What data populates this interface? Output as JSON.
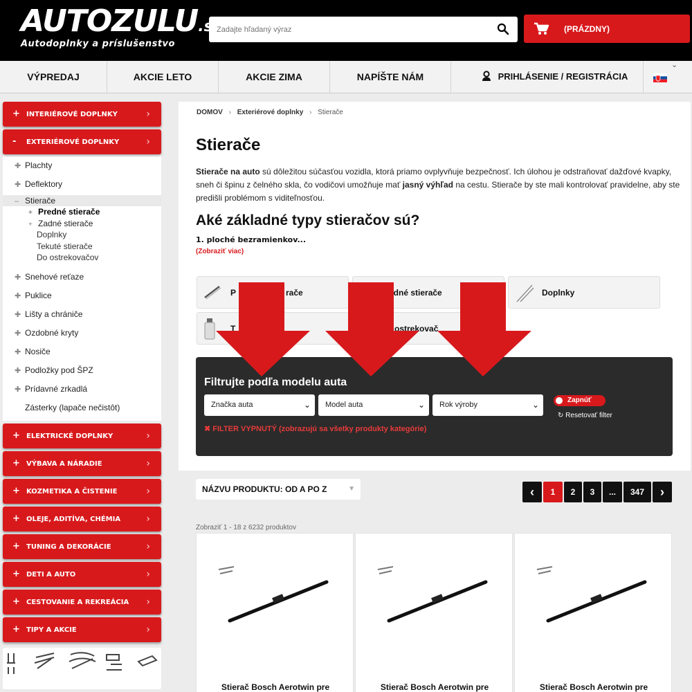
{
  "header": {
    "logo_text": "AUTOZULU",
    "logo_tld": ".sk",
    "tagline": "Autodoplnky a príslušenstvo",
    "search_placeholder": "Zadajte hľadaný výraz",
    "cart_label": "(PRÁZDNY)"
  },
  "topnav": {
    "items": [
      "VÝPREDAJ",
      "AKCIE LETO",
      "AKCIE ZIMA",
      "NAPÍŠTE NÁM"
    ],
    "login": "PRIHLÁSENIE / REGISTRÁCIA",
    "lang_chevron": "⌄"
  },
  "sidebar": {
    "categories_top": [
      {
        "sign": "+",
        "label": "INTERIÉROVÉ DOPLNKY"
      },
      {
        "sign": "-",
        "label": "EXTERIÉROVÉ DOPLNKY"
      }
    ],
    "sub_items": [
      "Plachty",
      "Deflektory"
    ],
    "active_item": "Stierače",
    "active_sign": "–",
    "stierace_children": [
      {
        "label": "Predné stierače",
        "sign": "+"
      },
      {
        "label": "Zadné stierače",
        "sign": "+"
      },
      {
        "label": "Doplnky"
      },
      {
        "label": "Tekuté stierače"
      },
      {
        "label": "Do ostrekovačov"
      }
    ],
    "sub_items_after": [
      "Snehové reťaze",
      "Puklice",
      "Lišty a chrániče",
      "Ozdobné kryty",
      "Nosiče",
      "Podložky pod ŠPZ",
      "Prídavné zrkadlá"
    ],
    "sub_item_last": "Zásterky (lapače nečistôt)",
    "categories_bottom": [
      {
        "sign": "+",
        "label": "ELEKTRICKÉ DOPLNKY"
      },
      {
        "sign": "+",
        "label": "VÝBAVA A NÁRADIE"
      },
      {
        "sign": "+",
        "label": "KOZMETIKA A ČISTENIE"
      },
      {
        "sign": "+",
        "label": "OLEJE, ADITÍVA, CHÉMIA"
      },
      {
        "sign": "+",
        "label": "TUNING A DEKORÁCIE"
      },
      {
        "sign": "+",
        "label": "DETI A AUTO"
      },
      {
        "sign": "+",
        "label": "CESTOVANIE A REKREÁCIA"
      },
      {
        "sign": "+",
        "label": "TIPY A AKCIE"
      }
    ],
    "chevron": "›"
  },
  "breadcrumb": [
    "DOMOV",
    "Exteriérové doplnky",
    "Stierače"
  ],
  "breadcrumb_sep": "›",
  "page": {
    "title": "Stierače",
    "desc_bold1": "Stierače na auto",
    "desc_part1": " sú dôležitou súčasťou vozidla, ktorá priamo ovplyvňuje bezpečnosť. Ich úlohou je odstraňovať dažďové kvapky, sneh či špinu z čelného skla, čo vodičovi umožňuje mať ",
    "desc_bold2": "jasný výhľad",
    "desc_part2": " na cestu. Stierače by ste mali kontrolovať pravidelne, aby ste predišli problémom s viditeľnosťou.",
    "subtitle": "Aké základné typy stieračov sú?",
    "list_item": "1. ploché bezramienkov...",
    "more_link": "(Zobraziť viac)"
  },
  "tiles": [
    "Predné stierače",
    "Zadné stierače",
    "Doplnky",
    "Tekuté stierače",
    "Do ostrekovačov"
  ],
  "tiles_visible_fragments": [
    "P",
    "rače",
    "adné stierače",
    "Doplnky",
    "T",
    "a",
    "ostrekovač"
  ],
  "filter": {
    "title": "Filtrujte podľa modelu auta",
    "brand_select": "Značka auta",
    "model_select": "Model auta",
    "year_select": "Rok výroby",
    "toggle_label": "Zapnúť",
    "reset_label": "Resetovať filter",
    "reset_icon": "↻",
    "status_icon": "✖",
    "status": "FILTER VYPNUTÝ (zobrazujú sa všetky produkty kategórie)",
    "select_arrow": "⌄"
  },
  "sort": {
    "label": "NÁZVU PRODUKTU: OD A PO Z",
    "arrow": "▼"
  },
  "pagination": {
    "prev": "‹",
    "pages": [
      "1",
      "2",
      "3",
      "...",
      "347"
    ],
    "next": "›",
    "current": "1"
  },
  "count_text": "Zobraziť 1 - 18 z 6232 produktov",
  "products": [
    {
      "title": "Stierač Bosch Aerotwin pre"
    },
    {
      "title": "Stierač Bosch Aerotwin pre"
    },
    {
      "title": "Stierač Bosch Aerotwin pre"
    }
  ],
  "colors": {
    "brand_red": "#d8191c",
    "header_black": "#000000",
    "filter_dark": "#2b2b2b"
  }
}
